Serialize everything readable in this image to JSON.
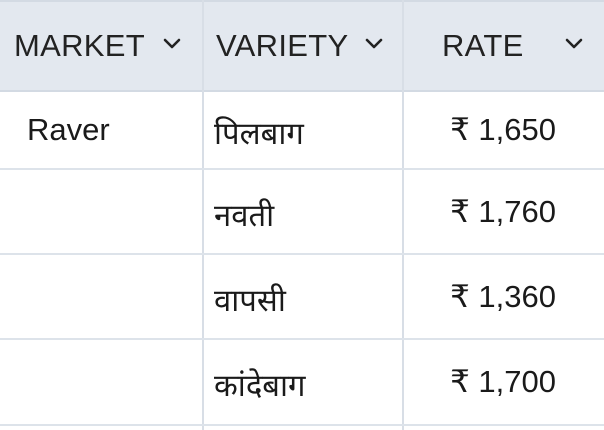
{
  "columns": [
    {
      "label": "MARKET"
    },
    {
      "label": "VARIETY"
    },
    {
      "label": "RATE"
    }
  ],
  "rows": [
    {
      "market": "Raver",
      "variety": "पिलबाग",
      "rate": "₹ 1,650"
    },
    {
      "market": "",
      "variety": "नवती",
      "rate": "₹ 1,760"
    },
    {
      "market": "",
      "variety": "वापसी",
      "rate": "₹ 1,360"
    },
    {
      "market": "",
      "variety": "कांदेबाग",
      "rate": "₹ 1,700"
    }
  ]
}
